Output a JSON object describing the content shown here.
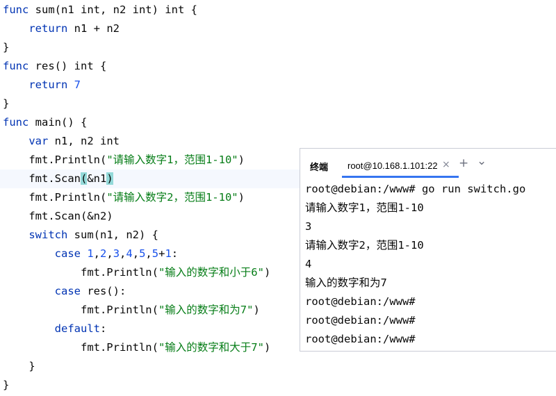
{
  "editor": {
    "lines": [
      [
        {
          "t": "func",
          "c": "kw"
        },
        {
          "t": " sum(n1 int, n2 int) int {"
        }
      ],
      [
        {
          "t": "    "
        },
        {
          "t": "return",
          "c": "kw"
        },
        {
          "t": " n1 + n2"
        }
      ],
      [
        {
          "t": "}"
        }
      ],
      [
        {
          "t": "func",
          "c": "kw"
        },
        {
          "t": " res() int {"
        }
      ],
      [
        {
          "t": "    "
        },
        {
          "t": "return",
          "c": "kw"
        },
        {
          "t": " "
        },
        {
          "t": "7",
          "c": "num"
        }
      ],
      [
        {
          "t": "}"
        }
      ],
      [
        {
          "t": "func",
          "c": "kw"
        },
        {
          "t": " main() {"
        }
      ],
      [
        {
          "t": "    "
        },
        {
          "t": "var",
          "c": "kw"
        },
        {
          "t": " n1, n2 int"
        }
      ],
      [
        {
          "t": "    fmt.Println("
        },
        {
          "t": "\"请输入数字1，范围1-10\"",
          "c": "str"
        },
        {
          "t": ")"
        }
      ],
      [
        {
          "t": "    fmt.Scan"
        },
        {
          "t": "(",
          "c": "brace-match"
        },
        {
          "t": "&n1"
        },
        {
          "t": ")",
          "c": "brace-match"
        }
      ],
      [
        {
          "t": "    fmt.Println("
        },
        {
          "t": "\"请输入数字2，范围1-10\"",
          "c": "str"
        },
        {
          "t": ")"
        }
      ],
      [
        {
          "t": "    fmt.Scan(&n2)"
        }
      ],
      [
        {
          "t": "    "
        },
        {
          "t": "switch",
          "c": "kw"
        },
        {
          "t": " sum(n1, n2) {"
        }
      ],
      [
        {
          "t": "        "
        },
        {
          "t": "case",
          "c": "kw"
        },
        {
          "t": " "
        },
        {
          "t": "1",
          "c": "num"
        },
        {
          "t": ","
        },
        {
          "t": "2",
          "c": "num"
        },
        {
          "t": ","
        },
        {
          "t": "3",
          "c": "num"
        },
        {
          "t": ","
        },
        {
          "t": "4",
          "c": "num"
        },
        {
          "t": ","
        },
        {
          "t": "5",
          "c": "num"
        },
        {
          "t": ","
        },
        {
          "t": "5",
          "c": "num"
        },
        {
          "t": "+"
        },
        {
          "t": "1",
          "c": "num"
        },
        {
          "t": ":"
        }
      ],
      [
        {
          "t": "            fmt.Println("
        },
        {
          "t": "\"输入的数字和小于6\"",
          "c": "str"
        },
        {
          "t": ")"
        }
      ],
      [
        {
          "t": "        "
        },
        {
          "t": "case",
          "c": "kw"
        },
        {
          "t": " res():"
        }
      ],
      [
        {
          "t": "            fmt.Println("
        },
        {
          "t": "\"输入的数字和为7\"",
          "c": "str"
        },
        {
          "t": ")"
        }
      ],
      [
        {
          "t": "        "
        },
        {
          "t": "default",
          "c": "kw"
        },
        {
          "t": ":"
        }
      ],
      [
        {
          "t": "            fmt.Println("
        },
        {
          "t": "\"输入的数字和大于7\"",
          "c": "str"
        },
        {
          "t": ")"
        }
      ],
      [
        {
          "t": "    }"
        }
      ],
      [
        {
          "t": "}"
        }
      ]
    ]
  },
  "terminal": {
    "panel_title": "终端",
    "tab_label": "root@10.168.1.101:22",
    "tab_close": "×",
    "new_tab": "+",
    "dropdown": "⌄",
    "lines": [
      "root@debian:/www# go run switch.go",
      "请输入数字1，范围1-10",
      "3",
      "请输入数字2，范围1-10",
      "4",
      "输入的数字和为7",
      "root@debian:/www#",
      "root@debian:/www#",
      "root@debian:/www#"
    ]
  }
}
